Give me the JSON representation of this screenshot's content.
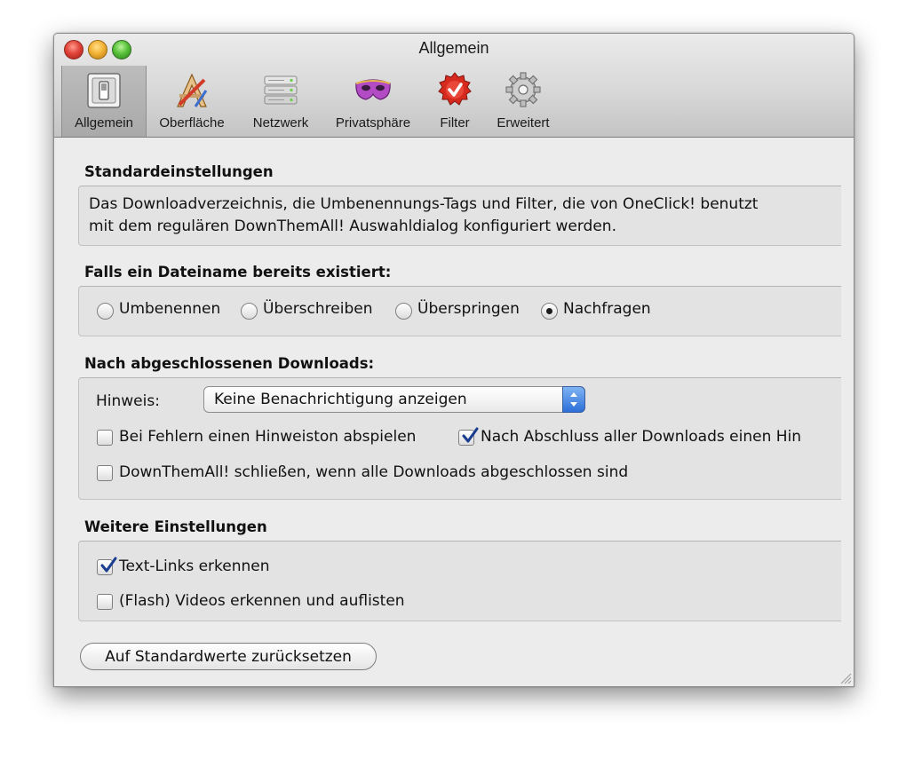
{
  "window": {
    "title": "Allgemein"
  },
  "toolbar": {
    "tabs": [
      {
        "label": "Allgemein",
        "icon": "switch-icon",
        "selected": true
      },
      {
        "label": "Oberfläche",
        "icon": "brush-pencil-ruler-icon",
        "selected": false
      },
      {
        "label": "Netzwerk",
        "icon": "network-server-icon",
        "selected": false
      },
      {
        "label": "Privatsphäre",
        "icon": "mask-icon",
        "selected": false
      },
      {
        "label": "Filter",
        "icon": "filter-badge-icon",
        "selected": false
      },
      {
        "label": "Erweitert",
        "icon": "gear-icon",
        "selected": false
      }
    ]
  },
  "standard": {
    "title": "Standardeinstellungen",
    "text_line1": "Das Downloadverzeichnis, die Umbenennungs-Tags und Filter, die von OneClick! benutzt",
    "text_line2": "mit dem regulären DownThemAll! Auswahldialog konfiguriert werden."
  },
  "exists": {
    "title": "Falls ein Dateiname bereits existiert:",
    "options": [
      {
        "label": "Umbenennen",
        "selected": false
      },
      {
        "label": "Überschreiben",
        "selected": false
      },
      {
        "label": "Überspringen",
        "selected": false
      },
      {
        "label": "Nachfragen",
        "selected": true
      }
    ]
  },
  "after": {
    "title": "Nach abgeschlossenen Downloads:",
    "hint_label": "Hinweis:",
    "hint_value": "Keine Benachrichtigung anzeigen",
    "check_errors": {
      "label": "Bei Fehlern einen Hinweiston abspielen",
      "checked": false
    },
    "check_finish": {
      "label": "Nach Abschluss aller Downloads einen Hin",
      "checked": true
    },
    "check_close": {
      "label": "DownThemAll! schließen, wenn alle Downloads abgeschlossen sind",
      "checked": false
    }
  },
  "more": {
    "title": "Weitere Einstellungen",
    "check_textlinks": {
      "label": "Text-Links erkennen",
      "checked": true
    },
    "check_flash": {
      "label": "(Flash) Videos erkennen und auflisten",
      "checked": false
    }
  },
  "reset_label": "Auf Standardwerte zurücksetzen",
  "colors": {
    "accent_blue": "#2c6fd8",
    "check_blue": "#1a3d8f"
  }
}
